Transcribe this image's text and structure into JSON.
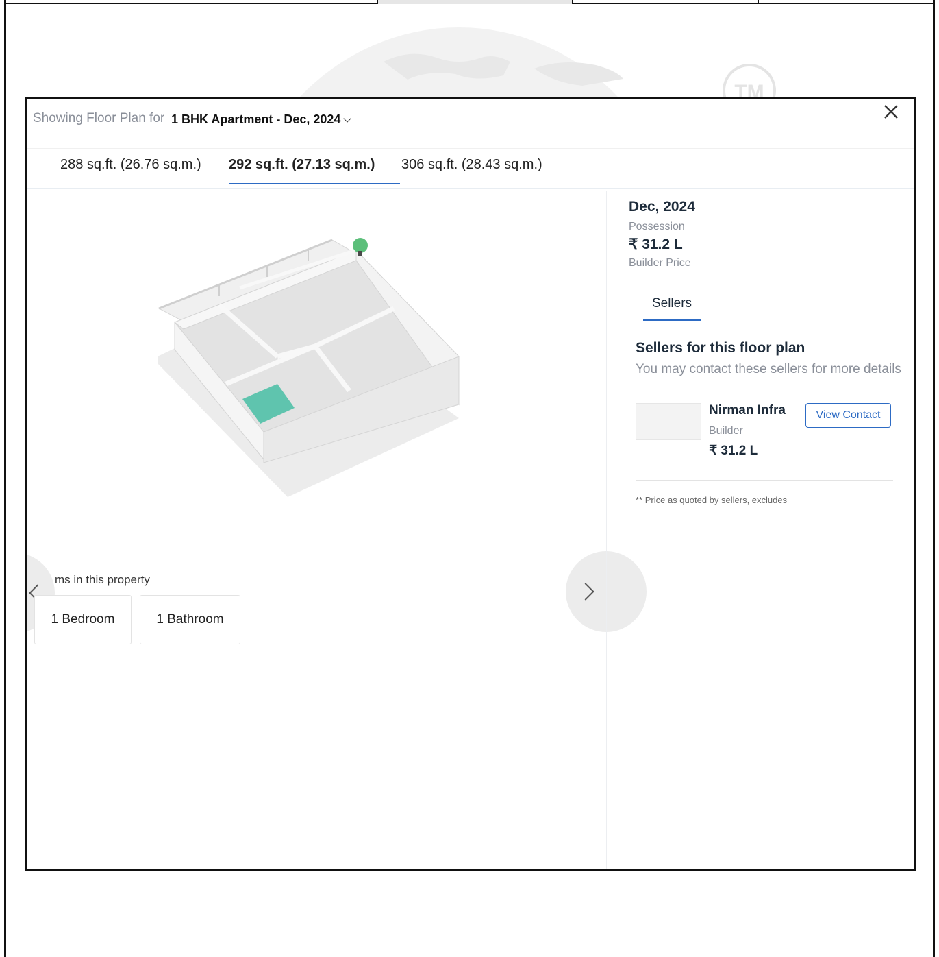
{
  "modal": {
    "header_prefix": "Showing Floor Plan for",
    "selected_config": "1 BHK Apartment - Dec, 2024",
    "close_symbol": "✕"
  },
  "tabs": [
    {
      "label": "288 sq.ft. (26.76 sq.m.)",
      "active": false
    },
    {
      "label": "292 sq.ft. (27.13 sq.m.)",
      "active": true
    },
    {
      "label": "306 sq.ft. (28.43 sq.m.)",
      "active": false
    }
  ],
  "rooms": {
    "title": "ms in this property",
    "items": [
      "1 Bedroom",
      "1 Bathroom"
    ]
  },
  "details": {
    "possession_date": "Dec, 2024",
    "possession_label": "Possession",
    "price": "₹ 31.2 L",
    "price_label": "Builder Price",
    "sellers_tab": "Sellers"
  },
  "sellers": {
    "heading": "Sellers for this floor plan",
    "subheading": "You may contact these sellers for more details",
    "list": [
      {
        "name": "Nirman Infra",
        "type": "Builder",
        "price": "₹ 31.2 L",
        "button": "View Contact"
      }
    ],
    "disclaimer": "** Price as quoted by sellers, excludes"
  },
  "colors": {
    "accent": "#2d6bc4",
    "room_highlight": "#5fc4ae",
    "marker": "#5cbf7a"
  },
  "icons": [
    "close-icon",
    "chevron-down-icon",
    "chevron-left-icon",
    "chevron-right-icon",
    "location-pin-icon"
  ]
}
